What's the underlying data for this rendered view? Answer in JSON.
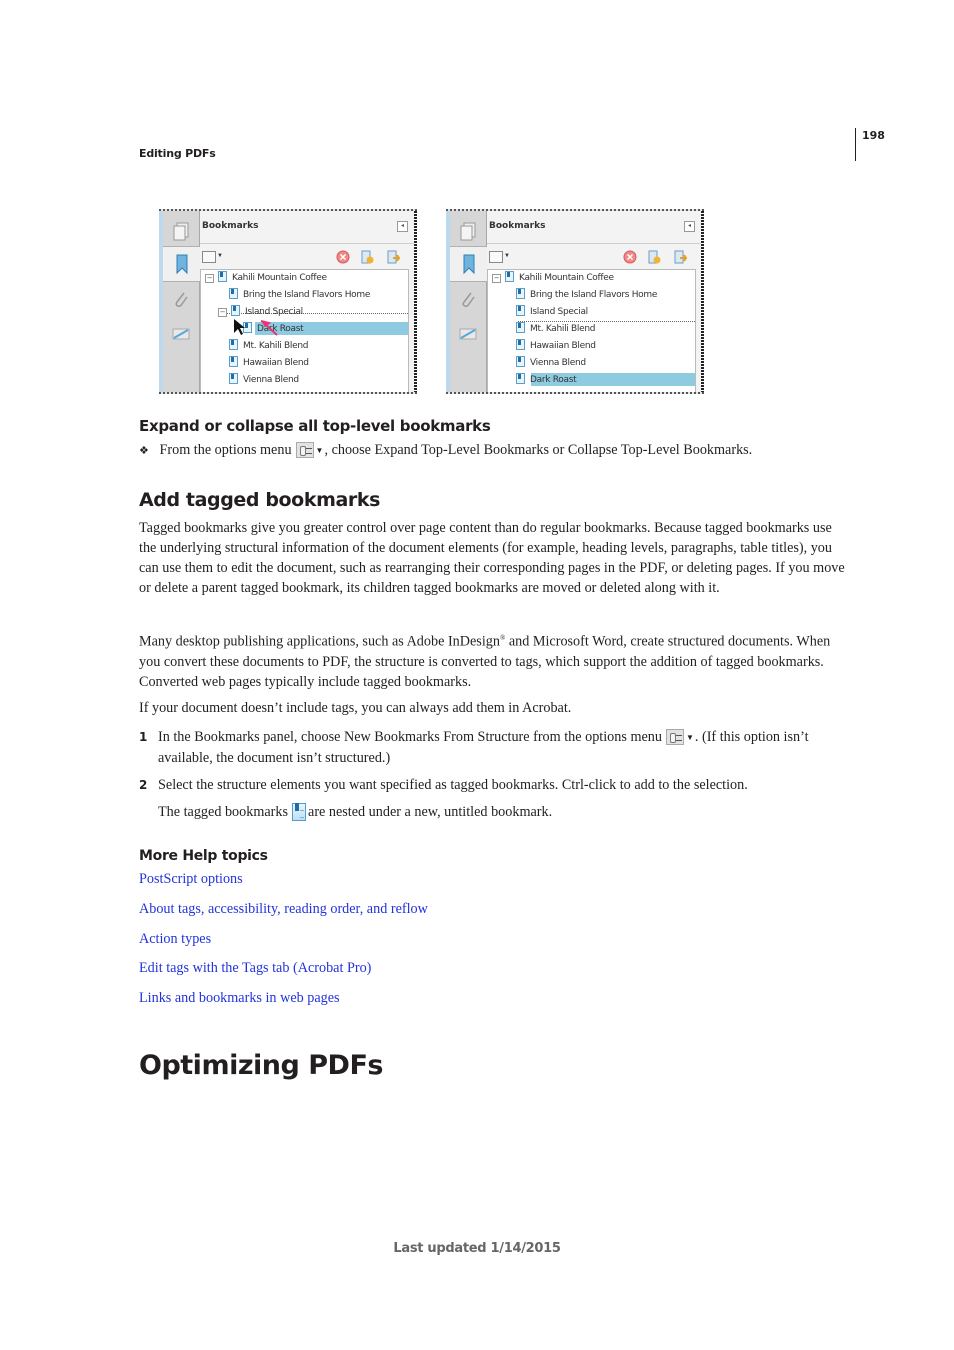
{
  "header": {
    "running_head": "Editing PDFs",
    "page_number": "198"
  },
  "figures": [
    {
      "panel_title": "Bookmarks",
      "tree": [
        {
          "label": "Kahili Mountain Coffee",
          "level": 0,
          "expander": "⊟"
        },
        {
          "label": "Bring the Island Flavors Home",
          "level": 1
        },
        {
          "label": "Island Special",
          "level": 1,
          "expander": "⊟"
        },
        {
          "label": "Dark Roast",
          "level": 2,
          "selected": true,
          "dragging": true
        },
        {
          "label": "Mt. Kahili Blend",
          "level": 1
        },
        {
          "label": "Hawaiian Blend",
          "level": 1
        },
        {
          "label": "Vienna Blend",
          "level": 1
        }
      ]
    },
    {
      "panel_title": "Bookmarks",
      "tree": [
        {
          "label": "Kahili Mountain Coffee",
          "level": 0,
          "expander": "⊟"
        },
        {
          "label": "Bring the Island Flavors Home",
          "level": 1
        },
        {
          "label": "Island Special",
          "level": 1
        },
        {
          "label": "Mt. Kahili Blend",
          "level": 1
        },
        {
          "label": "Hawaiian Blend",
          "level": 1
        },
        {
          "label": "Vienna Blend",
          "level": 1
        },
        {
          "label": "Dark Roast",
          "level": 1,
          "selected": true
        }
      ]
    }
  ],
  "section_expand": {
    "heading": "Expand or collapse all top-level bookmarks",
    "bullet": "❖",
    "text_before": "From the options menu",
    "text_after": ", choose Expand Top-Level Bookmarks or Collapse Top-Level Bookmarks."
  },
  "section_tagged": {
    "heading": "Add tagged bookmarks",
    "para1": "Tagged bookmarks give you greater control over page content than do regular bookmarks. Because tagged bookmarks use the underlying structural information of the document elements (for example, heading levels, paragraphs, table titles), you can use them to edit the document, such as rearranging their corresponding pages in the PDF, or deleting pages. If you move or delete a parent tagged bookmark, its children tagged bookmarks are moved or deleted along with it.",
    "para2_before": "Many desktop publishing applications, such as Adobe InDesign",
    "para2_reg": "®",
    "para2_after": " and Microsoft Word, create structured documents. When you convert these documents to PDF, the structure is converted to tags, which support the addition of tagged bookmarks. Converted web pages typically include tagged bookmarks.",
    "para3": "If your document doesn’t include tags, you can always add them in Acrobat.",
    "steps": [
      {
        "num": "1",
        "text_before": "In the Bookmarks panel, choose New Bookmarks From Structure from the options menu",
        "text_after": ". (If this option isn’t available, the document isn’t structured.)"
      },
      {
        "num": "2",
        "text": "Select the structure elements you want specified as tagged bookmarks. Ctrl-click to add to the selection."
      }
    ],
    "result_before": "The tagged bookmarks",
    "result_after": "are nested under a new, untitled bookmark."
  },
  "more_help": {
    "heading": "More Help topics",
    "links": [
      "PostScript options",
      "About tags, accessibility, reading order, and reflow",
      "Action types",
      "Edit tags with the Tags tab (Acrobat Pro)",
      "Links and bookmarks in web pages"
    ],
    "link_color": "#2233dd"
  },
  "next_section": {
    "heading": "Optimizing PDFs"
  },
  "footer": {
    "text": "Last updated 1/14/2015"
  }
}
